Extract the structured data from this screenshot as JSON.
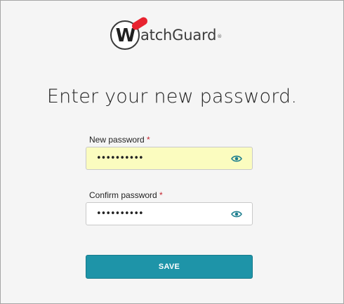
{
  "logo": {
    "mark_letter": "W",
    "text": "atchGuard",
    "trademark": "®",
    "accent_color": "#e8232f"
  },
  "heading": "Enter your new password.",
  "new_password": {
    "label": "New password",
    "required_marker": "*",
    "value_masked": "••••••••••",
    "icon": "eye-icon",
    "background": "#fbfcbf"
  },
  "confirm_password": {
    "label": "Confirm password",
    "required_marker": "*",
    "value_masked": "••••••••••",
    "icon": "eye-icon",
    "background": "#ffffff"
  },
  "save_button": {
    "label": "SAVE",
    "color": "#1e94a8"
  }
}
